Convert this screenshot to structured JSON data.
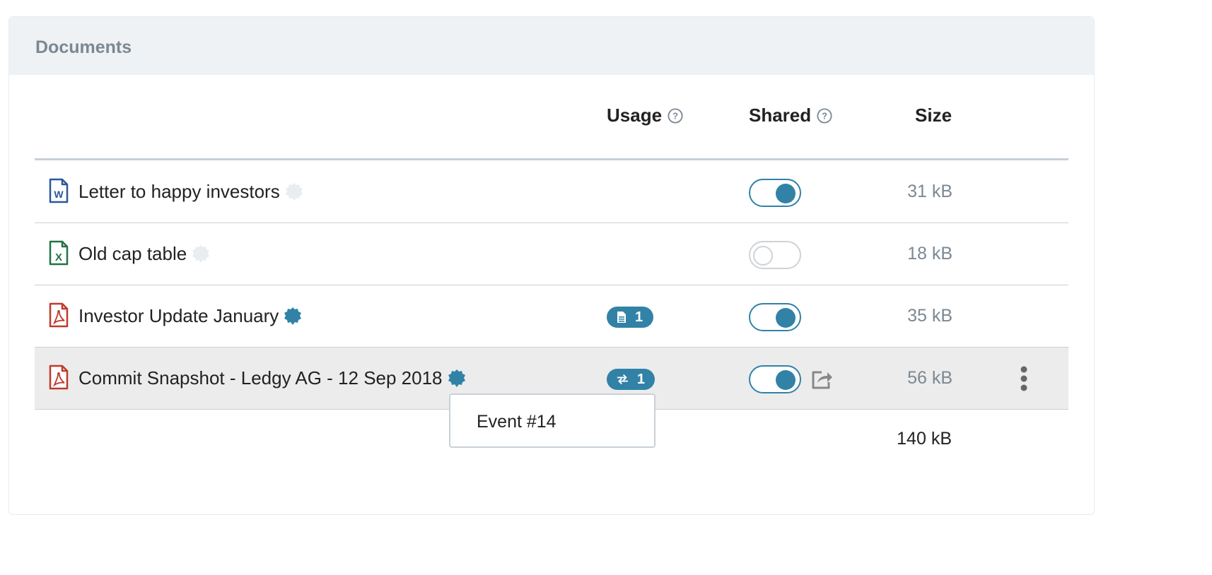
{
  "panel": {
    "title": "Documents"
  },
  "table": {
    "columns": {
      "usage": "Usage",
      "shared": "Shared",
      "size": "Size"
    },
    "rows": [
      {
        "name": "Letter to happy investors",
        "file_type": "word-file-icon",
        "file_color": "#2b579a",
        "signed": false,
        "usage": null,
        "shared": true,
        "size": "31 kB"
      },
      {
        "name": "Old cap table",
        "file_type": "excel-file-icon",
        "file_color": "#217346",
        "signed": false,
        "usage": null,
        "shared": false,
        "size": "18 kB"
      },
      {
        "name": "Investor Update January",
        "file_type": "pdf-file-icon",
        "file_color": "#c0392b",
        "signed": true,
        "usage": {
          "icon": "document-icon",
          "count": "1"
        },
        "shared": true,
        "size": "35 kB"
      },
      {
        "name": "Commit Snapshot - Ledgy AG - 12 Sep 2018",
        "file_type": "pdf-file-icon",
        "file_color": "#c0392b",
        "signed": true,
        "usage": {
          "icon": "transfer-icon",
          "count": "1"
        },
        "shared": true,
        "size": "56 kB",
        "hovered": true
      }
    ],
    "total_size": "140 kB"
  },
  "popover": {
    "items": [
      "Event #14"
    ]
  },
  "colors": {
    "accent": "#3182a6",
    "seal_inactive": "#e9edf0",
    "header_bg": "#eef2f4",
    "muted_text": "#7b8894"
  }
}
